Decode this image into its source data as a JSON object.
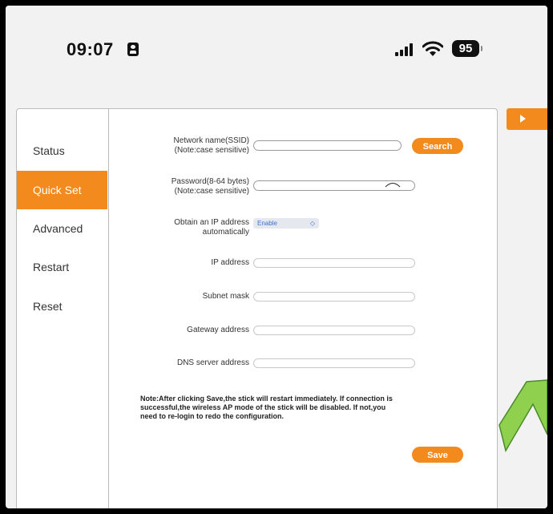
{
  "status_bar": {
    "time": "09:07",
    "battery": "95"
  },
  "sidebar": {
    "items": [
      {
        "label": "Status",
        "active": false
      },
      {
        "label": "Quick Set",
        "active": true
      },
      {
        "label": "Advanced",
        "active": false
      },
      {
        "label": "Restart",
        "active": false
      },
      {
        "label": "Reset",
        "active": false
      }
    ]
  },
  "form": {
    "ssid_label": "Network name(SSID)",
    "ssid_note": "(Note:case sensitive)",
    "ssid_value": "",
    "search_label": "Search",
    "password_label": "Password(8-64 bytes)",
    "password_note": "(Note:case sensitive)",
    "password_value": "",
    "obtain_ip_label": "Obtain an IP address",
    "obtain_ip_label2": "automatically",
    "obtain_ip_value": "Enable",
    "ip_label": "IP address",
    "subnet_label": "Subnet mask",
    "gateway_label": "Gateway address",
    "dns_label": "DNS server address",
    "note_line1": "Note:After clicking Save,the stick will restart immediately. If connection is",
    "note_line2": "successful,the wireless AP mode of the stick will be disabled. If not,you",
    "note_line3": "need to re-login to redo the configuration.",
    "save_label": "Save"
  },
  "colors": {
    "accent": "#f28a1e",
    "arrow": "#8fd14f"
  }
}
